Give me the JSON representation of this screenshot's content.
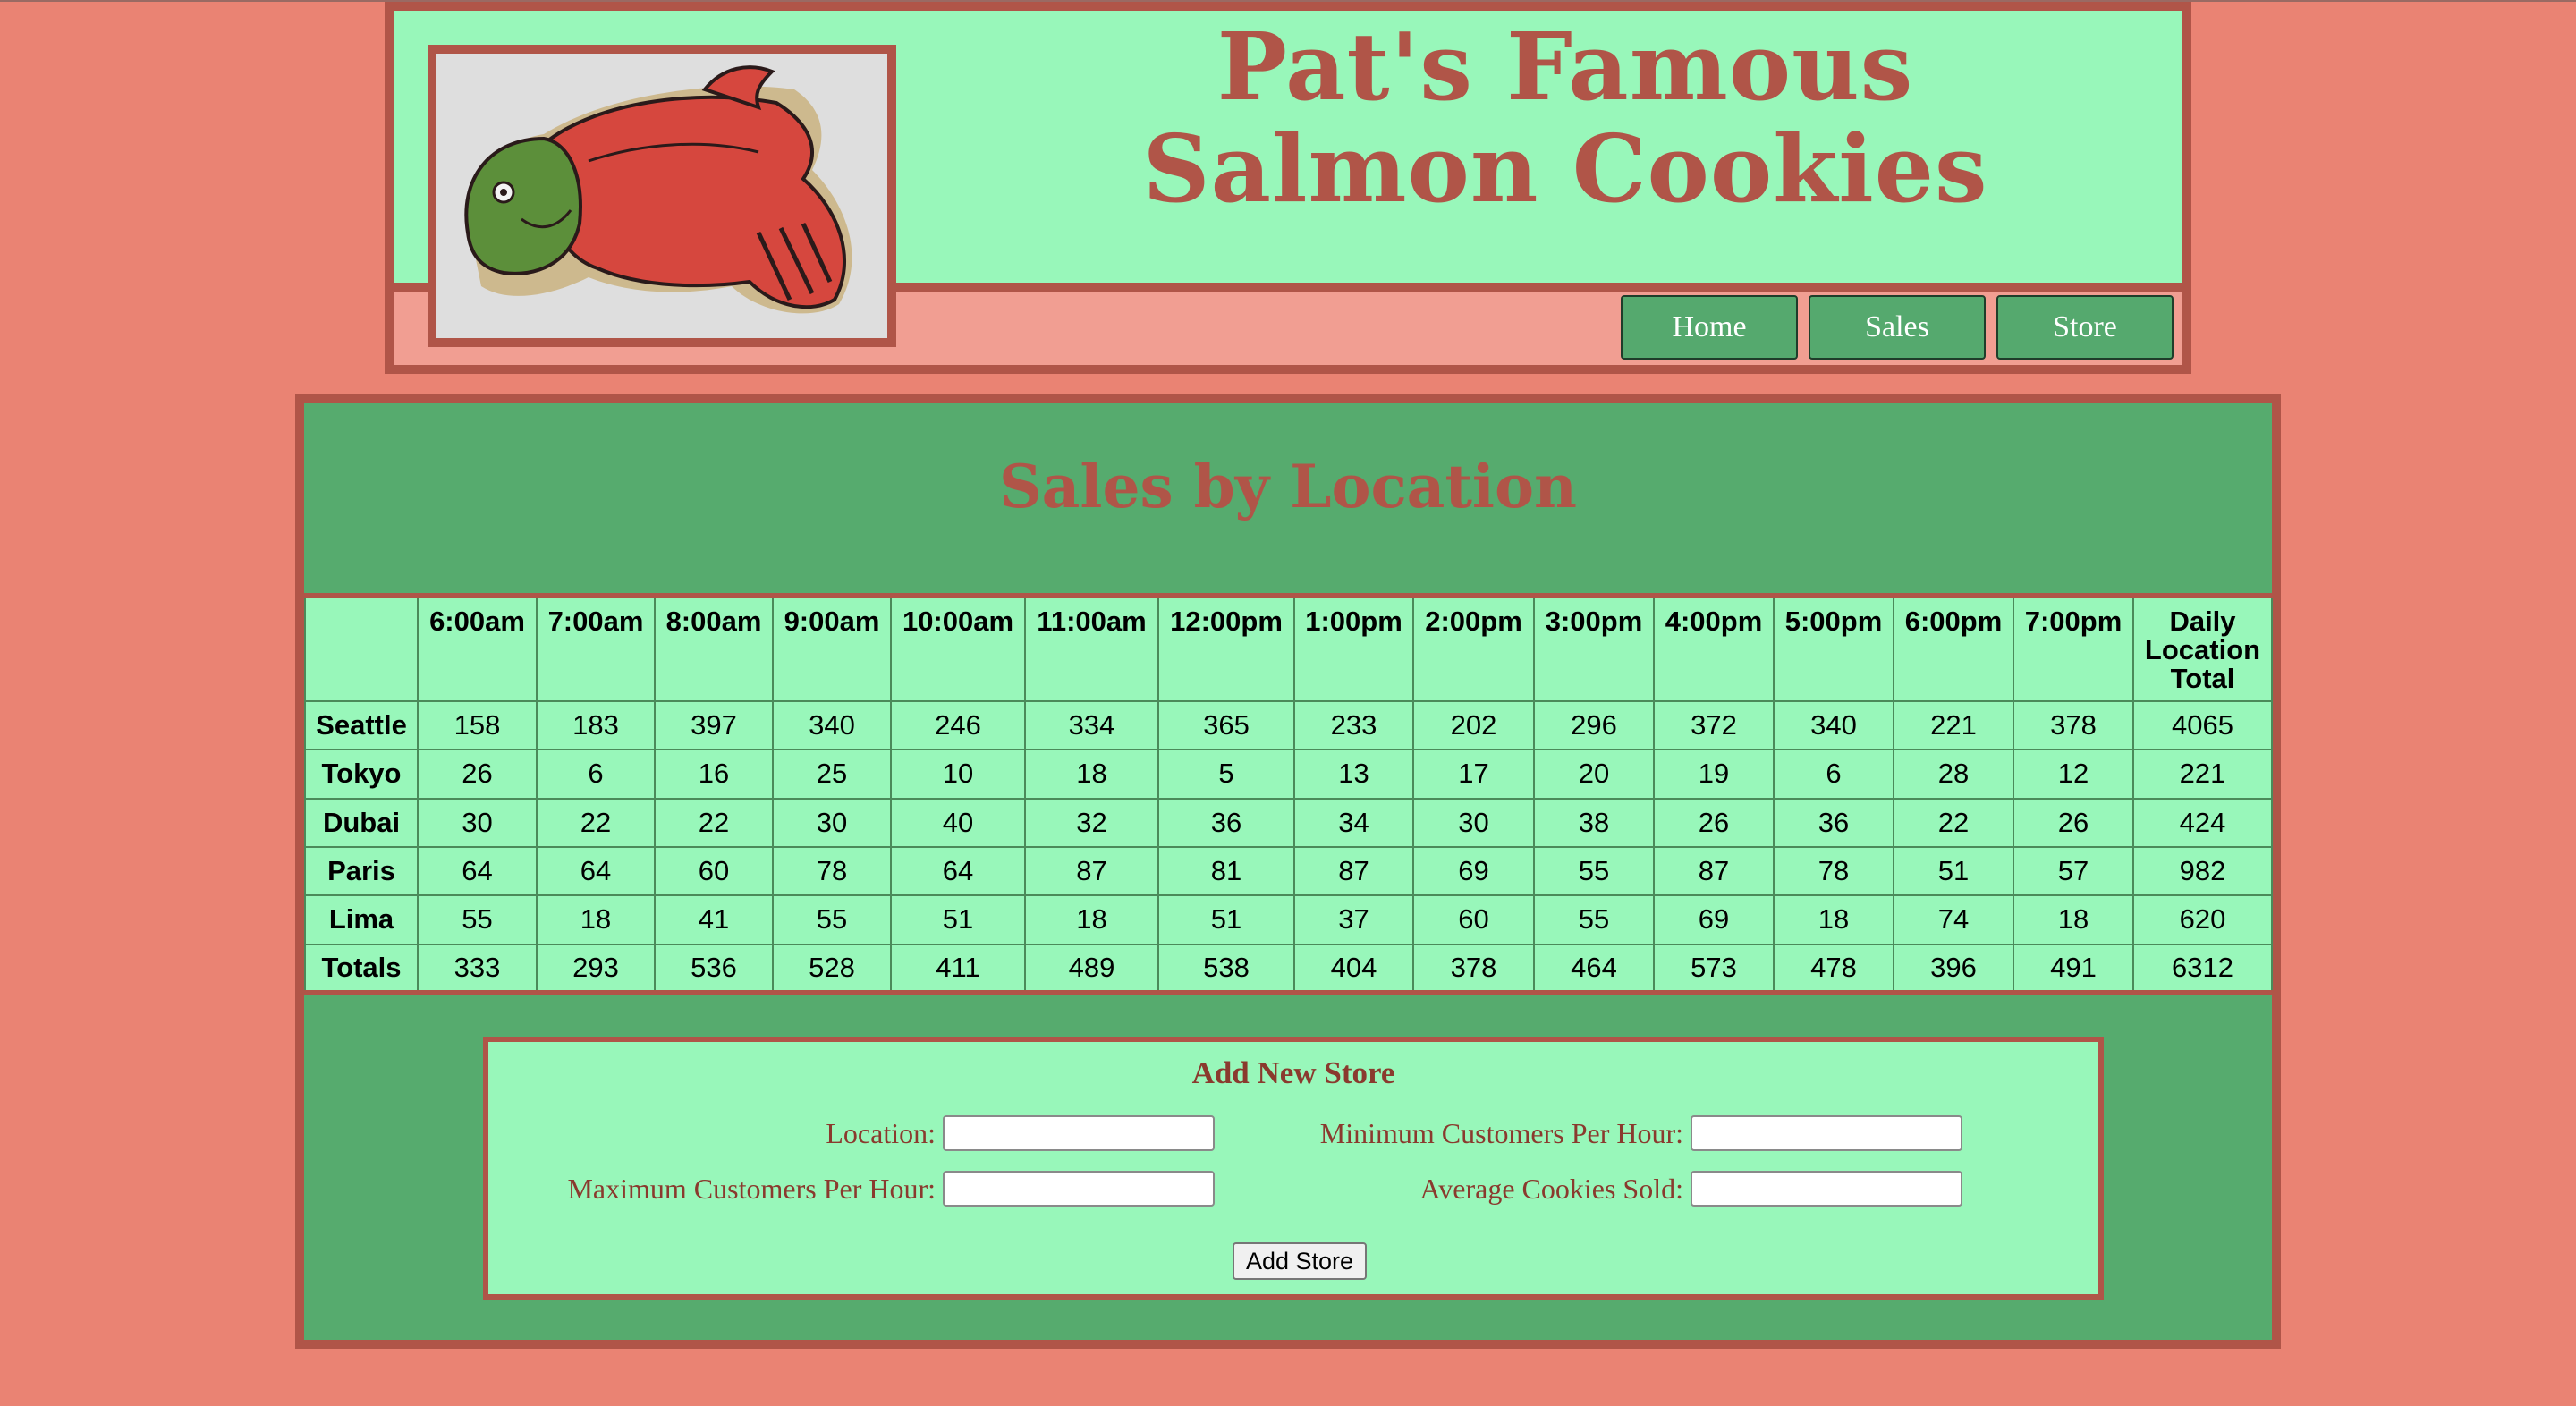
{
  "header": {
    "title_line1": "Pat's Famous",
    "title_line2": "Salmon Cookies",
    "logo_icon": "salmon-cookie-photo",
    "nav": [
      "Home",
      "Sales",
      "Store"
    ]
  },
  "sales": {
    "title": "Sales by Location",
    "columns": [
      "",
      "6:00am",
      "7:00am",
      "8:00am",
      "9:00am",
      "10:00am",
      "11:00am",
      "12:00pm",
      "1:00pm",
      "2:00pm",
      "3:00pm",
      "4:00pm",
      "5:00pm",
      "6:00pm",
      "7:00pm",
      "Daily Location Total"
    ],
    "rows": [
      {
        "location": "Seattle",
        "values": [
          "158",
          "183",
          "397",
          "340",
          "246",
          "334",
          "365",
          "233",
          "202",
          "296",
          "372",
          "340",
          "221",
          "378",
          "4065"
        ]
      },
      {
        "location": "Tokyo",
        "values": [
          "26",
          "6",
          "16",
          "25",
          "10",
          "18",
          "5",
          "13",
          "17",
          "20",
          "19",
          "6",
          "28",
          "12",
          "221"
        ]
      },
      {
        "location": "Dubai",
        "values": [
          "30",
          "22",
          "22",
          "30",
          "40",
          "32",
          "36",
          "34",
          "30",
          "38",
          "26",
          "36",
          "22",
          "26",
          "424"
        ]
      },
      {
        "location": "Paris",
        "values": [
          "64",
          "64",
          "60",
          "78",
          "64",
          "87",
          "81",
          "87",
          "69",
          "55",
          "87",
          "78",
          "51",
          "57",
          "982"
        ]
      },
      {
        "location": "Lima",
        "values": [
          "55",
          "18",
          "41",
          "55",
          "51",
          "18",
          "51",
          "37",
          "60",
          "55",
          "69",
          "18",
          "74",
          "18",
          "620"
        ]
      },
      {
        "location": "Totals",
        "values": [
          "333",
          "293",
          "536",
          "528",
          "411",
          "489",
          "538",
          "404",
          "378",
          "464",
          "573",
          "478",
          "396",
          "491",
          "6312"
        ]
      }
    ]
  },
  "form": {
    "title": "Add New Store",
    "location_label": "Location:",
    "min_label": "Minimum Customers Per Hour:",
    "max_label": "Maximum Customers Per Hour:",
    "avg_label": "Average Cookies Sold:",
    "location_value": "",
    "min_value": "",
    "max_value": "",
    "avg_value": "",
    "submit_label": "Add Store"
  },
  "colors": {
    "page_bg": "#ea8373",
    "banner_bg": "#98f7ba",
    "border": "#b05548",
    "main_bg": "#56ab6e",
    "nav_bg": "#55a96e"
  }
}
